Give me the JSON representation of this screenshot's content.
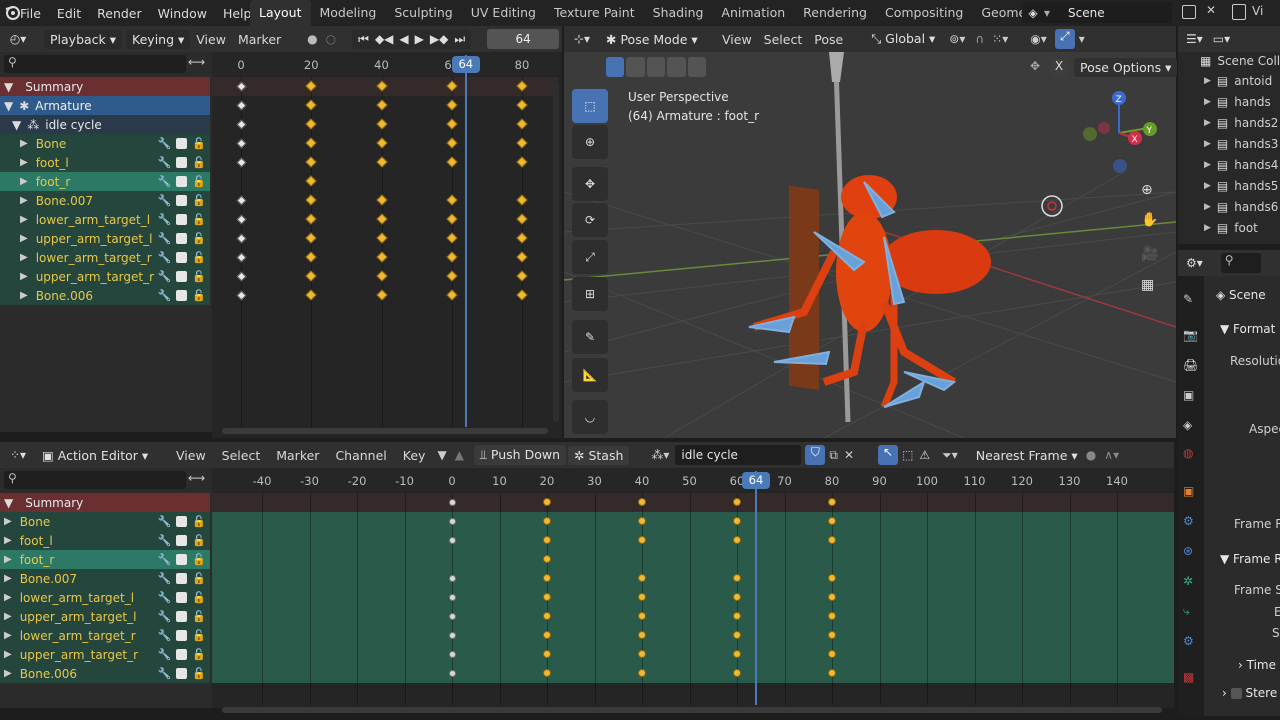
{
  "menu": {
    "file": "File",
    "edit": "Edit",
    "render": "Render",
    "window": "Window",
    "help": "Help",
    "workspaces": [
      "Layout",
      "Modeling",
      "Sculpting",
      "UV Editing",
      "Texture Paint",
      "Shading",
      "Animation",
      "Rendering",
      "Compositing",
      "Geometry Nodes"
    ],
    "active_workspace": "Layout",
    "scene": "Scene"
  },
  "timeline": {
    "playback": "Playback",
    "keying": "Keying",
    "view": "View",
    "marker": "Marker",
    "frame": "64",
    "ruler": [
      "0",
      "20",
      "40",
      "60",
      "80"
    ],
    "current": "64"
  },
  "dopesheet_top": {
    "summary": "Summary",
    "armature": "Armature",
    "action": "idle cycle",
    "channels": [
      "Bone",
      "foot_l",
      "foot_r",
      "Bone.007",
      "lower_arm_target_l",
      "upper_arm_target_l",
      "lower_arm_target_r",
      "upper_arm_target_r",
      "Bone.006"
    ]
  },
  "viewport": {
    "mode": "Pose Mode",
    "view": "View",
    "select": "Select",
    "pose": "Pose",
    "orientation": "Global",
    "overlay_line1": "User Perspective",
    "overlay_line2": "(64) Armature : foot_r",
    "pose_options": "Pose Options",
    "x_label": "X"
  },
  "action_editor": {
    "editor": "Action Editor",
    "view": "View",
    "select": "Select",
    "marker": "Marker",
    "channel": "Channel",
    "key": "Key",
    "push_down": "Push Down",
    "stash": "Stash",
    "action_name": "idle cycle",
    "snap": "Nearest Frame",
    "ruler": [
      "-40",
      "-30",
      "-20",
      "-10",
      "0",
      "10",
      "20",
      "30",
      "40",
      "50",
      "60",
      "70",
      "80",
      "90",
      "100",
      "110",
      "120",
      "130",
      "140"
    ],
    "current": "64",
    "summary": "Summary",
    "channels": [
      "Bone",
      "foot_l",
      "foot_r",
      "Bone.007",
      "lower_arm_target_l",
      "upper_arm_target_l",
      "lower_arm_target_r",
      "upper_arm_target_r",
      "Bone.006"
    ]
  },
  "outliner": {
    "title": "Scene Colle",
    "items": [
      "antoid",
      "hands",
      "hands2",
      "hands3",
      "hands4",
      "hands5",
      "hands6",
      "foot"
    ]
  },
  "properties": {
    "scene": "Scene",
    "format": "Format",
    "resolution": "Resolution",
    "aspect": "Aspec",
    "frame_rate": "Frame Ra",
    "frame_range": "Frame R",
    "frame_start": "Frame St",
    "e": "E",
    "s": "S",
    "time": "Time",
    "stereo": "Stere"
  }
}
